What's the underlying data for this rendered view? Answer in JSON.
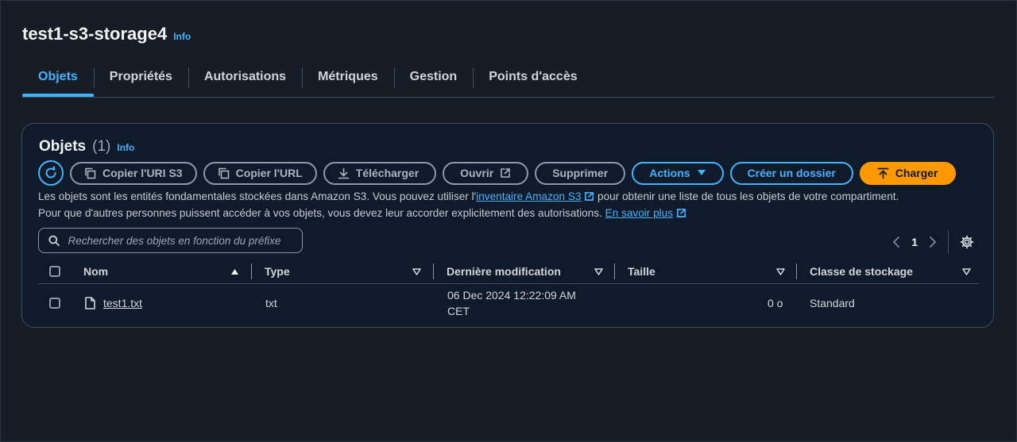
{
  "header": {
    "title": "test1-s3-storage4",
    "info": "Info"
  },
  "tabs": [
    "Objets",
    "Propriétés",
    "Autorisations",
    "Métriques",
    "Gestion",
    "Points d'accès"
  ],
  "panel": {
    "title": "Objets",
    "count": "(1)",
    "info": "Info",
    "buttons": {
      "copy_uri": "Copier l'URI S3",
      "copy_url": "Copier l'URL",
      "download": "Télécharger",
      "open": "Ouvrir",
      "delete": "Supprimer",
      "actions": "Actions",
      "create_folder": "Créer un dossier",
      "upload": "Charger"
    },
    "description": {
      "part1": "Les objets sont les entités fondamentales stockées dans Amazon S3. Vous pouvez utiliser l'",
      "link1": "inventaire Amazon S3",
      "part2": " pour obtenir une liste de tous les objets de votre compartiment.",
      "part3": "Pour que d'autres personnes puissent accéder à vos objets, vous devez leur accorder explicitement des autorisations. ",
      "link2": "En savoir plus"
    },
    "search_placeholder": "Rechercher des objets en fonction du préfixe",
    "page": "1"
  },
  "table": {
    "columns": [
      "Nom",
      "Type",
      "Dernière modification",
      "Taille",
      "Classe de stockage"
    ],
    "rows": [
      {
        "name": "test1.txt",
        "type": "txt",
        "modified_line1": "06 Dec 2024 12:22:09 AM",
        "modified_line2": "CET",
        "size": "0 o",
        "storage_class": "Standard"
      }
    ]
  },
  "colors": {
    "accent": "#42b4ff",
    "primary": "#ff9900",
    "background": "#161d26",
    "panel": "#0f1b2a"
  }
}
